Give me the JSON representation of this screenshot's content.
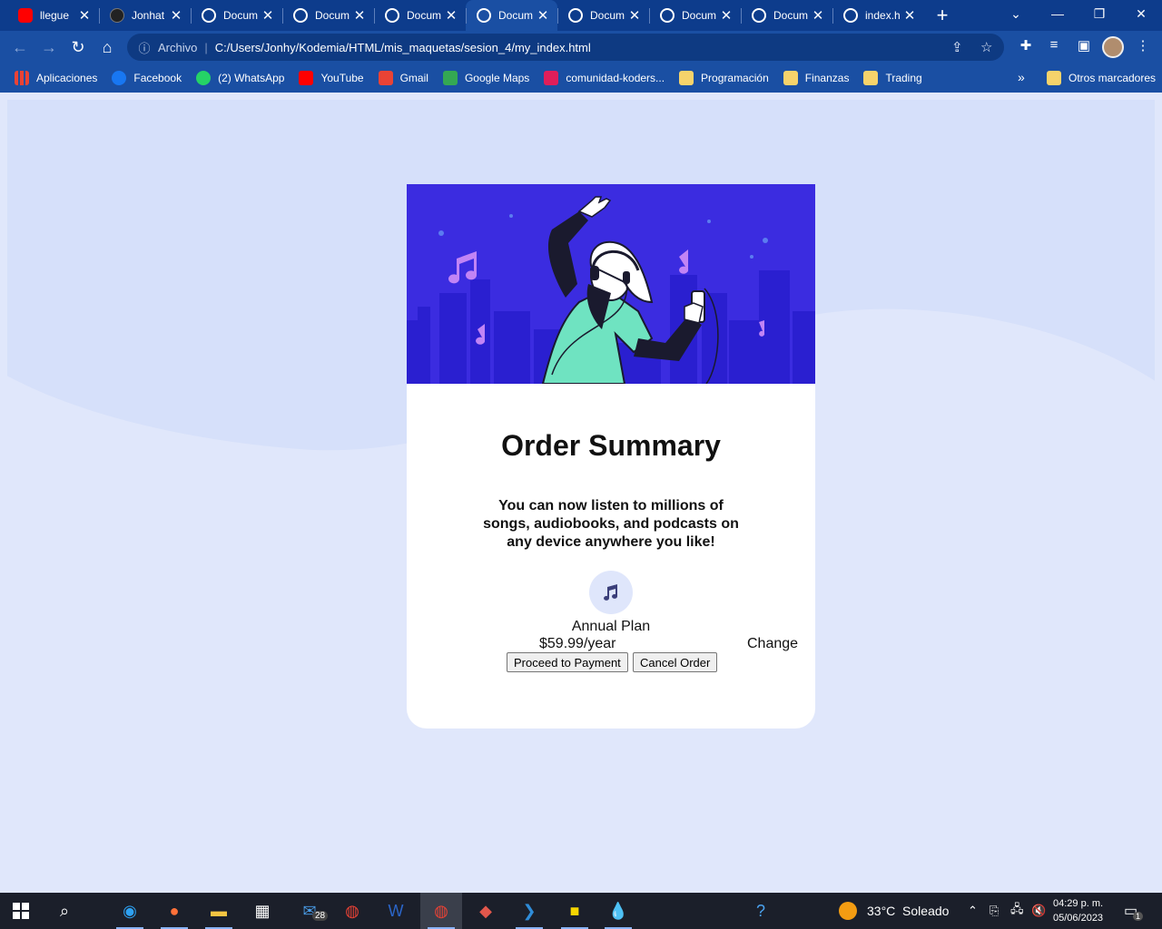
{
  "browser": {
    "tabs": [
      {
        "title": "llegue",
        "favicon": "youtube-icon",
        "color": "#ff0000"
      },
      {
        "title": "Jonhat",
        "favicon": "github-icon",
        "color": "#222222"
      },
      {
        "title": "Docum",
        "favicon": "globe-icon",
        "color": "#ffffff"
      },
      {
        "title": "Docum",
        "favicon": "globe-icon",
        "color": "#ffffff"
      },
      {
        "title": "Docum",
        "favicon": "globe-icon",
        "color": "#ffffff"
      },
      {
        "title": "Docum",
        "favicon": "globe-icon",
        "color": "#ffffff",
        "active": true
      },
      {
        "title": "Docum",
        "favicon": "globe-icon",
        "color": "#ffffff"
      },
      {
        "title": "Docum",
        "favicon": "globe-icon",
        "color": "#ffffff"
      },
      {
        "title": "Docum",
        "favicon": "globe-icon",
        "color": "#ffffff"
      },
      {
        "title": "index.h",
        "favicon": "globe-icon",
        "color": "#ffffff"
      }
    ],
    "close_glyph": "✕",
    "new_tab_glyph": "+",
    "address": {
      "scheme_label": "Archivo",
      "separator": "|",
      "url": "C:/Users/Jonhy/Kodemia/HTML/mis_maquetas/sesion_4/my_index.html"
    },
    "bookmarks": [
      {
        "label": "Aplicaciones",
        "icon": "apps-grid-icon"
      },
      {
        "label": "Facebook",
        "icon": "facebook-icon",
        "color": "#1877f2"
      },
      {
        "label": "(2) WhatsApp",
        "icon": "whatsapp-icon",
        "color": "#25d366"
      },
      {
        "label": "YouTube",
        "icon": "youtube-icon",
        "color": "#ff0000"
      },
      {
        "label": "Gmail",
        "icon": "gmail-icon",
        "color": "#ea4335"
      },
      {
        "label": "Google Maps",
        "icon": "maps-pin-icon",
        "color": "#34a853"
      },
      {
        "label": "comunidad-koders...",
        "icon": "slack-icon",
        "color": "#e01e5a"
      },
      {
        "label": "Programación",
        "icon": "folder-icon",
        "color": "#f6d36b"
      },
      {
        "label": "Finanzas",
        "icon": "folder-icon",
        "color": "#f6d36b"
      },
      {
        "label": "Trading",
        "icon": "folder-icon",
        "color": "#f6d36b"
      }
    ],
    "bookmarks_overflow": "»",
    "other_bookmarks": "Otros marcadores"
  },
  "page": {
    "title": "Order Summary",
    "description": "You can now listen to millions of songs, audiobooks, and podcasts on any device anywhere you like!",
    "plan_name": "Annual Plan",
    "plan_price": "$59.99/year",
    "change_label": "Change",
    "proceed_label": "Proceed to Payment",
    "cancel_label": "Cancel Order",
    "colors": {
      "hero": "#3b2ce0",
      "background": "#e0e7fb",
      "card": "#ffffff"
    }
  },
  "taskbar": {
    "weather": "33°C  Soleado",
    "time": "04:29 p. m.",
    "date": "05/06/2023",
    "mail_badge": "28",
    "notification_badge": "1"
  }
}
